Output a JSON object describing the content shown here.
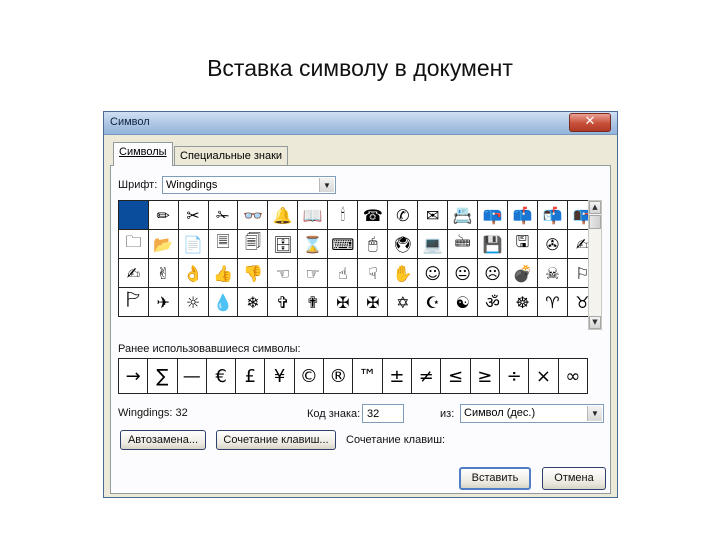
{
  "slide": {
    "title": "Вставка символу в документ"
  },
  "dialog": {
    "title": "Символ",
    "close_glyph": "✕",
    "tabs": [
      {
        "label": "Символы"
      },
      {
        "label": "Специальные знаки"
      }
    ],
    "font": {
      "label": "Шрифт:",
      "value": "Wingdings"
    },
    "symbols": [
      [
        "",
        "✏",
        "✂",
        "✁",
        "👓",
        "🔔",
        "📖",
        "🕯",
        "☎",
        "✆",
        "✉",
        "📇",
        "📪",
        "📫",
        "📬",
        "📭"
      ],
      [
        "🗀",
        "📂",
        "📄",
        "🗏",
        "🗐",
        "🗄",
        "⌛",
        "⌨",
        "🖱",
        "🖲",
        "💻",
        "🖮",
        "💾",
        "🖫",
        "✇",
        "✍"
      ],
      [
        "✍",
        "✌",
        "👌",
        "👍",
        "👎",
        "☜",
        "☞",
        "☝",
        "☟",
        "✋",
        "☺",
        "😐",
        "☹",
        "💣",
        "☠",
        "⚐"
      ],
      [
        "🏱",
        "✈",
        "☼",
        "💧",
        "❄",
        "✞",
        "✟",
        "✠",
        "✠",
        "✡",
        "☪",
        "☯",
        "ॐ",
        "☸",
        "♈",
        "♉"
      ]
    ],
    "recent": {
      "label": "Ранее использовавшиеся символы:",
      "items": [
        "→",
        "∑",
        "—",
        "€",
        "£",
        "¥",
        "©",
        "®",
        "™",
        "±",
        "≠",
        "≤",
        "≥",
        "÷",
        "×",
        "∞"
      ]
    },
    "char_info": "Wingdings: 32",
    "code": {
      "label": "Код знака:",
      "value": "32"
    },
    "from": {
      "label": "из:",
      "value": "Символ (дес.)"
    },
    "autocorrect_button": "Автозамена...",
    "shortcut_button": "Сочетание клавиш...",
    "shortcut_text": "Сочетание клавиш:",
    "insert_button": "Вставить",
    "cancel_button": "Отмена"
  }
}
